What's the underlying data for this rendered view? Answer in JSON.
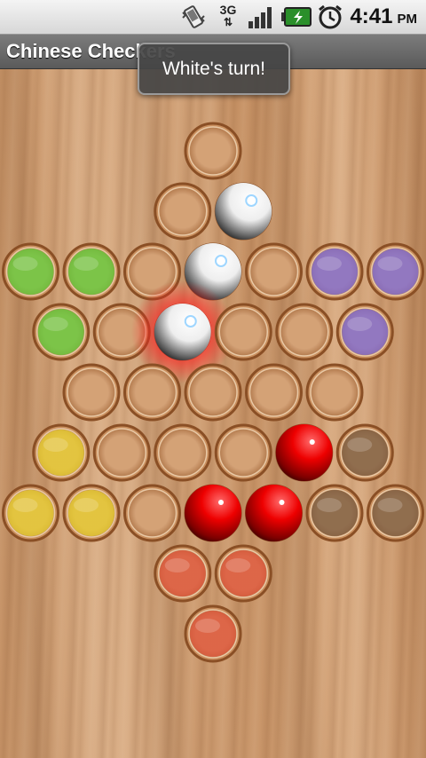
{
  "status_bar": {
    "time": "4:41",
    "ampm": "PM",
    "network_label": "3G",
    "icons": [
      "vibrate-icon",
      "network-3g-icon",
      "signal-icon",
      "battery-charging-icon",
      "alarm-icon"
    ]
  },
  "app": {
    "title": "Chinese Checkers"
  },
  "toast": {
    "message": "White's turn!"
  },
  "colors": {
    "green": "#5fcf3a",
    "purple": "#7c6ad8",
    "yellow": "#e8d02e",
    "brown": "#7a5c42",
    "red_target": "#e0533a",
    "red_piece": "#e00000",
    "white_piece": "#ffffff",
    "selection_glow": "#ff2020"
  },
  "board": {
    "rows": [
      [
        "empty"
      ],
      [
        "empty",
        "white"
      ],
      [
        "green",
        "green",
        "empty",
        "white",
        "empty",
        "purple",
        "purple"
      ],
      [
        "green",
        "empty",
        "white-selected",
        "empty",
        "empty",
        "purple"
      ],
      [
        "empty",
        "empty",
        "empty",
        "empty",
        "empty"
      ],
      [
        "yellow",
        "empty",
        "empty",
        "empty",
        "red",
        "brown"
      ],
      [
        "yellow",
        "yellow",
        "empty",
        "red",
        "red",
        "brown",
        "brown"
      ],
      [
        "red-target",
        "red-target"
      ],
      [
        "red-target"
      ]
    ]
  }
}
